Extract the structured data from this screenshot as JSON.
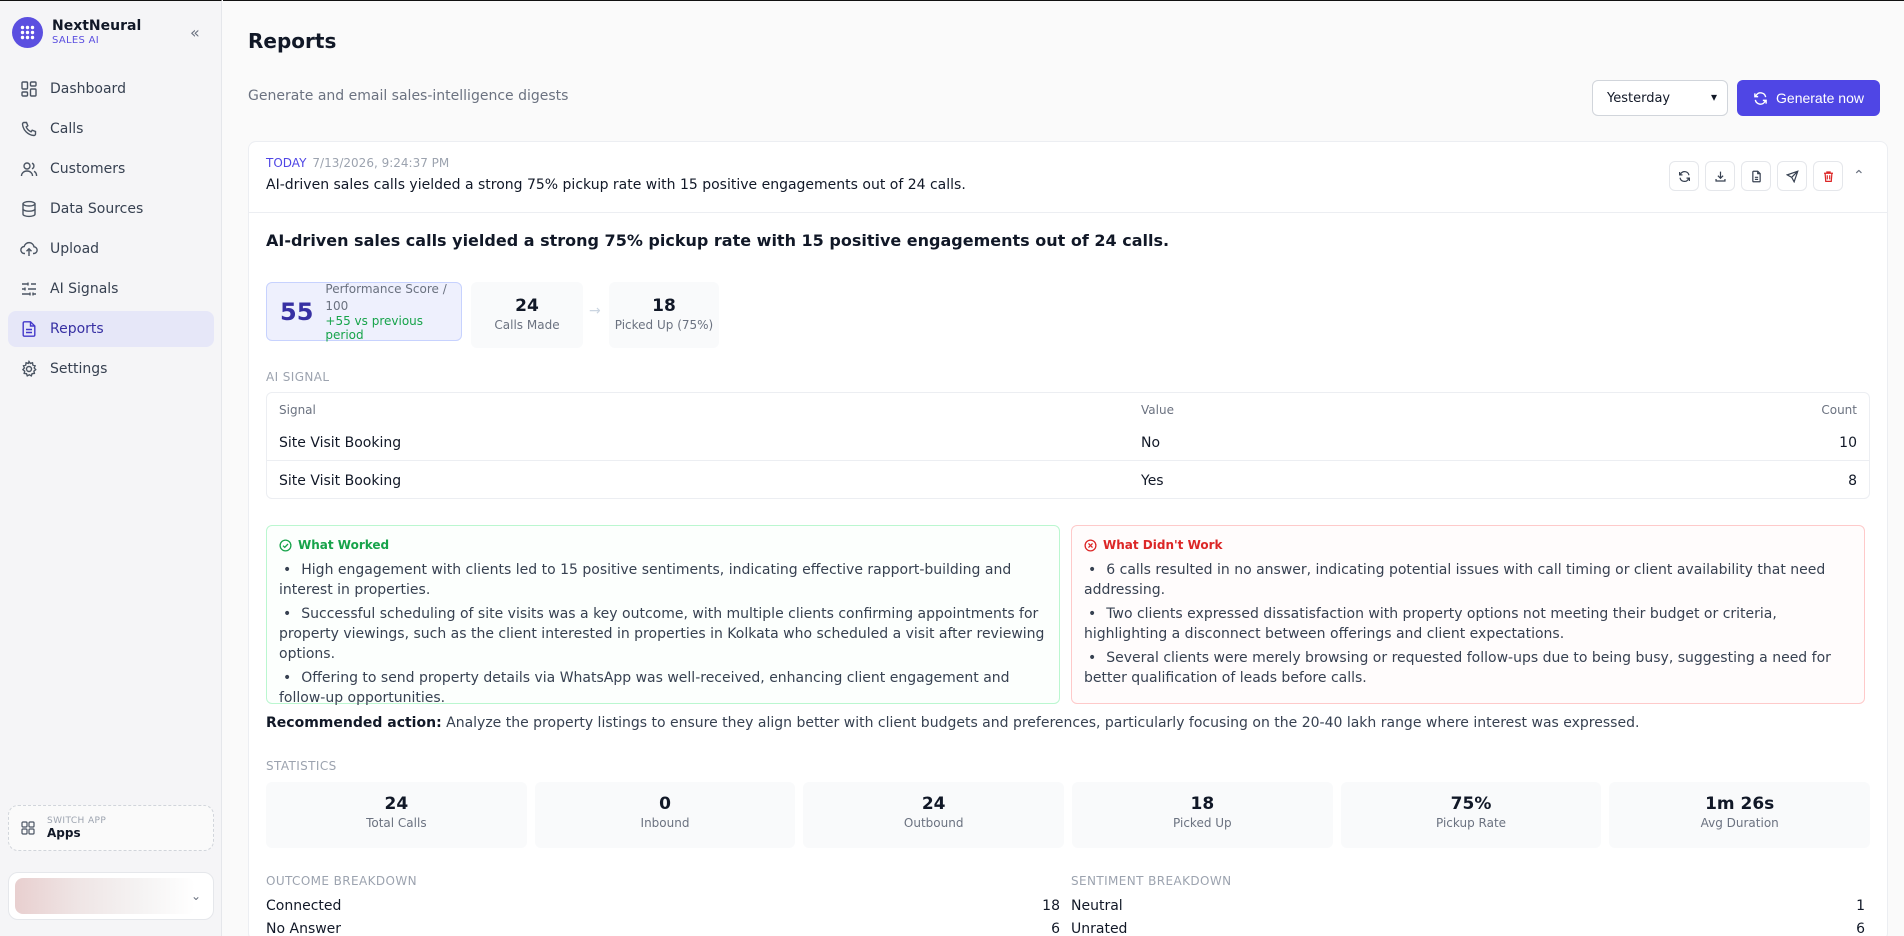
{
  "brand": {
    "name": "NextNeural",
    "subtitle": "SALES AI"
  },
  "nav": [
    {
      "label": "Dashboard",
      "icon": "dashboard-icon"
    },
    {
      "label": "Calls",
      "icon": "phone-icon"
    },
    {
      "label": "Customers",
      "icon": "users-icon"
    },
    {
      "label": "Data Sources",
      "icon": "database-icon"
    },
    {
      "label": "Upload",
      "icon": "cloud-upload-icon"
    },
    {
      "label": "AI Signals",
      "icon": "sliders-icon"
    },
    {
      "label": "Reports",
      "icon": "file-text-icon",
      "active": true
    },
    {
      "label": "Settings",
      "icon": "gear-icon"
    }
  ],
  "switch_app": {
    "label": "SWITCH APP",
    "value": "Apps"
  },
  "page": {
    "title": "Reports",
    "subtitle": "Generate and email sales-intelligence digests",
    "period": "Yesterday",
    "generate_label": "Generate now"
  },
  "report": {
    "tag": "TODAY",
    "timestamp": "7/13/2026, 9:24:37 PM",
    "summary": "AI-driven sales calls yielded a strong 75% pickup rate with 15 positive engagements out of 24 calls.",
    "headline": "AI-driven sales calls yielded a strong 75% pickup rate with 15 positive engagements out of 24 calls.",
    "score": {
      "value": "55",
      "label": "Performance Score / 100",
      "delta": "+55 vs previous period"
    },
    "calls_made": {
      "value": "24",
      "label": "Calls Made"
    },
    "picked_up": {
      "value": "18",
      "label": "Picked Up (75%)"
    },
    "ai_signal": {
      "section": "AI SIGNAL",
      "headers": [
        "Signal",
        "Value",
        "Count"
      ],
      "rows": [
        [
          "Site Visit Booking",
          "No",
          "10"
        ],
        [
          "Site Visit Booking",
          "Yes",
          "8"
        ]
      ]
    },
    "what_worked": {
      "title": "What Worked",
      "items": [
        "High engagement with clients led to 15 positive sentiments, indicating effective rapport-building and interest in properties.",
        "Successful scheduling of site visits was a key outcome, with multiple clients confirming appointments for property viewings, such as the client interested in properties in Kolkata who scheduled a visit after reviewing options.",
        "Offering to send property details via WhatsApp was well-received, enhancing client engagement and follow-up opportunities."
      ]
    },
    "what_didnt": {
      "title": "What Didn't Work",
      "items": [
        "6 calls resulted in no answer, indicating potential issues with call timing or client availability that need addressing.",
        "Two clients expressed dissatisfaction with property options not meeting their budget or criteria, highlighting a disconnect between offerings and client expectations.",
        "Several clients were merely browsing or requested follow-ups due to being busy, suggesting a need for better qualification of leads before calls."
      ]
    },
    "recommended": {
      "label": "Recommended action:",
      "text": "Analyze the property listings to ensure they align better with client budgets and preferences, particularly focusing on the 20-40 lakh range where interest was expressed."
    },
    "statistics": {
      "section": "STATISTICS",
      "items": [
        {
          "value": "24",
          "label": "Total Calls"
        },
        {
          "value": "0",
          "label": "Inbound"
        },
        {
          "value": "24",
          "label": "Outbound"
        },
        {
          "value": "18",
          "label": "Picked Up"
        },
        {
          "value": "75%",
          "label": "Pickup Rate"
        },
        {
          "value": "1m 26s",
          "label": "Avg Duration"
        }
      ]
    },
    "outcome": {
      "section": "OUTCOME BREAKDOWN",
      "rows": [
        {
          "label": "Connected",
          "value": "18"
        },
        {
          "label": "No Answer",
          "value": "6"
        }
      ]
    },
    "sentiment": {
      "section": "SENTIMENT BREAKDOWN",
      "rows": [
        {
          "label": "Neutral",
          "value": "1"
        },
        {
          "label": "Unrated",
          "value": "6"
        }
      ]
    }
  },
  "colors": {
    "accent": "#4f46e5",
    "positive": "#16a34a",
    "negative": "#dc2626"
  }
}
